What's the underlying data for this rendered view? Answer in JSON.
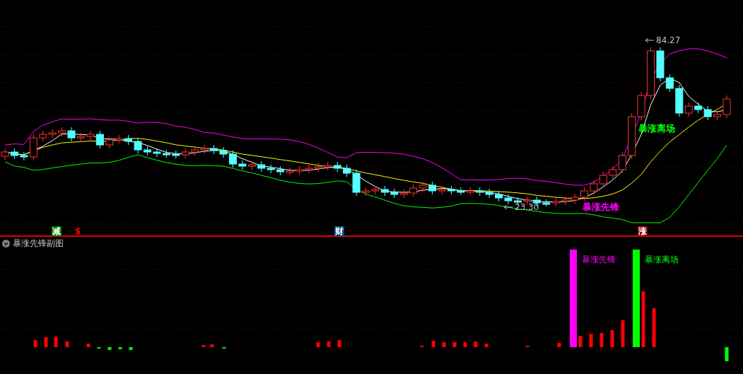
{
  "main_chart": {
    "high_label": "84.27",
    "low_label": "23.30",
    "annotations": [
      {
        "text": "暴涨先锋",
        "color": "#ff00ff"
      },
      {
        "text": "暴涨离场",
        "color": "#00ff00"
      }
    ],
    "markers": [
      {
        "text": "减",
        "kind": "box",
        "color": "#008000"
      },
      {
        "text": "$",
        "kind": "plain",
        "color": "#ff0000"
      },
      {
        "text": "财",
        "kind": "box",
        "color": "#0a4a8a"
      },
      {
        "text": "涨",
        "kind": "box",
        "color": "#8b0000"
      }
    ]
  },
  "sub_chart": {
    "title": "暴涨先锋副图",
    "labels": [
      {
        "text": "暴涨先锋",
        "color": "#ff00ff"
      },
      {
        "text": "暴涨离场",
        "color": "#00ff00"
      }
    ]
  }
}
